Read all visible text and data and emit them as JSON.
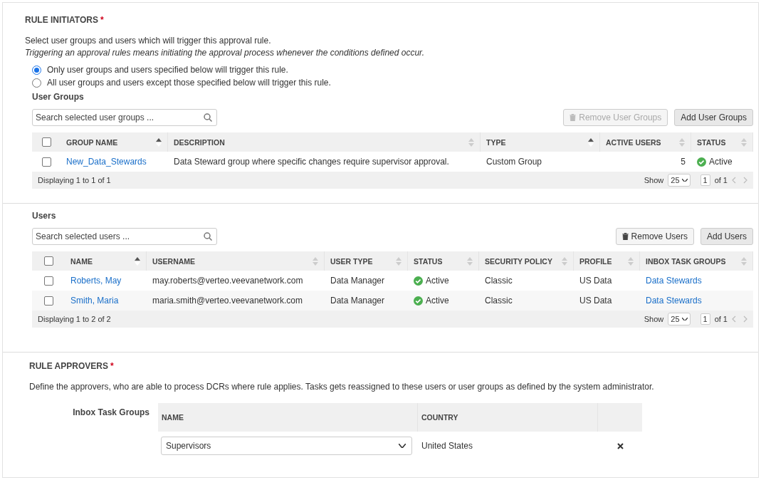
{
  "initiators": {
    "title": "RULE INITIATORS",
    "required": "*",
    "intro": "Select user groups and users which will trigger this approval rule.",
    "note": "Triggering an approval rules means initiating the approval process whenever the conditions defined occur.",
    "radios": [
      {
        "label": "Only user groups and users specified below will trigger this rule.",
        "selected": true
      },
      {
        "label": "All user groups and users except those specified below will trigger this rule.",
        "selected": false
      }
    ]
  },
  "user_groups": {
    "heading": "User Groups",
    "search": {
      "placeholder": "Search selected user groups ..."
    },
    "buttons": [
      {
        "kind": "remove",
        "label": "Remove User Groups",
        "disabled": true
      },
      {
        "kind": "add",
        "label": "Add User Groups",
        "disabled": false
      }
    ],
    "select_all": {
      "checked": false
    },
    "columns": [
      {
        "label": "GROUP NAME",
        "sorted": true
      },
      {
        "label": "DESCRIPTION",
        "sorted": false
      },
      {
        "label": "TYPE",
        "sorted": true
      },
      {
        "label": "ACTIVE USERS",
        "sorted": false
      },
      {
        "label": "STATUS",
        "sorted": false
      }
    ],
    "rows": [
      {
        "checked": false,
        "cells": [
          {
            "kind": "link",
            "text": "New_Data_Stewards"
          },
          {
            "kind": "text",
            "text": "Data Steward group where specific changes require supervisor approval."
          },
          {
            "kind": "text",
            "text": "Custom Group"
          },
          {
            "kind": "number",
            "text": "5"
          },
          {
            "kind": "status",
            "text": "Active"
          }
        ]
      }
    ],
    "footer": {
      "displaying": "Displaying 1 to 1 of 1",
      "show": "Show",
      "page_size": "25",
      "page": "1",
      "of": "of 1"
    }
  },
  "users": {
    "heading": "Users",
    "search": {
      "placeholder": "Search selected users ..."
    },
    "buttons": [
      {
        "kind": "remove",
        "label": "Remove Users",
        "disabled": false
      },
      {
        "kind": "add",
        "label": "Add Users",
        "disabled": false
      }
    ],
    "select_all": {
      "checked": false
    },
    "columns": [
      {
        "label": "NAME",
        "sorted": true
      },
      {
        "label": "USERNAME",
        "sorted": false
      },
      {
        "label": "USER TYPE",
        "sorted": false
      },
      {
        "label": "STATUS",
        "sorted": false
      },
      {
        "label": "SECURITY POLICY",
        "sorted": false
      },
      {
        "label": "PROFILE",
        "sorted": false
      },
      {
        "label": "INBOX TASK GROUPS",
        "sorted": false
      }
    ],
    "rows": [
      {
        "checked": false,
        "cells": [
          {
            "kind": "link",
            "text": "Roberts, May"
          },
          {
            "kind": "text",
            "text": "may.roberts@verteo.veevanetwork.com"
          },
          {
            "kind": "text",
            "text": "Data Manager"
          },
          {
            "kind": "status",
            "text": "Active"
          },
          {
            "kind": "text",
            "text": "Classic"
          },
          {
            "kind": "text",
            "text": "US Data"
          },
          {
            "kind": "link",
            "text": "Data Stewards"
          }
        ]
      },
      {
        "checked": false,
        "cells": [
          {
            "kind": "link",
            "text": "Smith, Maria"
          },
          {
            "kind": "text",
            "text": "maria.smith@verteo.veevanetwork.com"
          },
          {
            "kind": "text",
            "text": "Data Manager"
          },
          {
            "kind": "status",
            "text": "Active"
          },
          {
            "kind": "text",
            "text": "Classic"
          },
          {
            "kind": "text",
            "text": "US Data"
          },
          {
            "kind": "link",
            "text": "Data Stewards"
          }
        ]
      }
    ],
    "footer": {
      "displaying": "Displaying 1 to 2 of 2",
      "show": "Show",
      "page_size": "25",
      "page": "1",
      "of": "of 1"
    }
  },
  "approvers": {
    "title": "RULE APPROVERS",
    "required": "*",
    "description": "Define the approvers, who are able to process DCRs where rule applies. Tasks gets reassigned to these users or user groups as defined by the system administrator.",
    "label": "Inbox Task Groups",
    "columns": [
      "NAME",
      "COUNTRY"
    ],
    "rows": [
      {
        "name": "Supervisors",
        "country": "United States"
      }
    ]
  }
}
